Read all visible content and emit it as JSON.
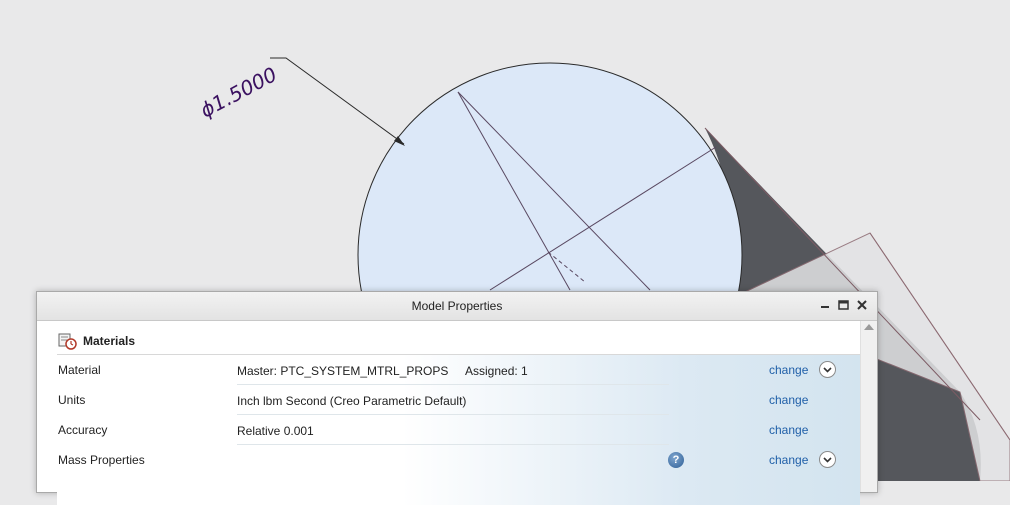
{
  "viewport": {
    "dimension_label": "ϕ1.5000"
  },
  "dialog": {
    "title": "Model Properties",
    "section_title": "Materials",
    "rows": [
      {
        "name": "Material",
        "value": "Master: PTC_SYSTEM_MTRL_PROPS",
        "assigned": "Assigned: 1",
        "change": "change"
      },
      {
        "name": "Units",
        "value": "Inch lbm Second (Creo Parametric Default)",
        "change": "change"
      },
      {
        "name": "Accuracy",
        "value": "Relative 0.001",
        "change": "change"
      },
      {
        "name": "Mass Properties",
        "value": "",
        "change": "change",
        "help": "?"
      }
    ]
  }
}
